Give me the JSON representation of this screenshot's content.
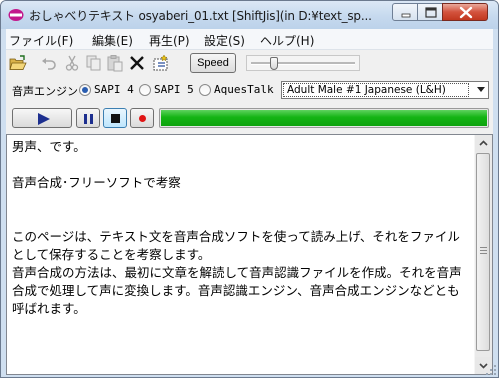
{
  "window": {
    "title": "おしゃべりテキスト osyaberi_01.txt [ShiftJis](in D:¥text_sp..."
  },
  "menu": [
    {
      "label": "ファイル(F)",
      "name": "menu-file"
    },
    {
      "label": "編集(E)",
      "name": "menu-edit"
    },
    {
      "label": "再生(P)",
      "name": "menu-play"
    },
    {
      "label": "設定(S)",
      "name": "menu-settings"
    },
    {
      "label": "ヘルプ(H)",
      "name": "menu-help"
    }
  ],
  "toolbar": {
    "icons": [
      "open-folder-icon",
      "undo-icon",
      "cut-icon",
      "copy-icon",
      "paste-icon",
      "delete-icon",
      "select-all-icon"
    ],
    "speed_label": "Speed",
    "speed_slider_value": 0.2
  },
  "engine": {
    "label": "音声エンジン",
    "options": [
      {
        "label": "SAPI 4",
        "selected": true
      },
      {
        "label": "SAPI 5",
        "selected": false
      },
      {
        "label": "AquesTalk",
        "selected": false
      }
    ],
    "voice_selected": "Adult Male #1 Japanese (L&H)"
  },
  "playback": {
    "buttons": [
      "play-icon",
      "pause-icon",
      "stop-icon",
      "record-icon"
    ],
    "progress": 1.0,
    "progress_color": "#14b414"
  },
  "editor": {
    "text": "男声、です。\n\n音声合成･フリーソフトで考察\n\n\nこのページは、テキスト文を音声合成ソフトを使って読み上げ、それをファイルとして保存することを考察します。\n音声合成の方法は、最初に文章を解読して音声認識ファイルを作成。それを音声合成で処理して声に変換します。音声認識エンジン、音声合成エンジンなどとも呼ばれます。"
  }
}
